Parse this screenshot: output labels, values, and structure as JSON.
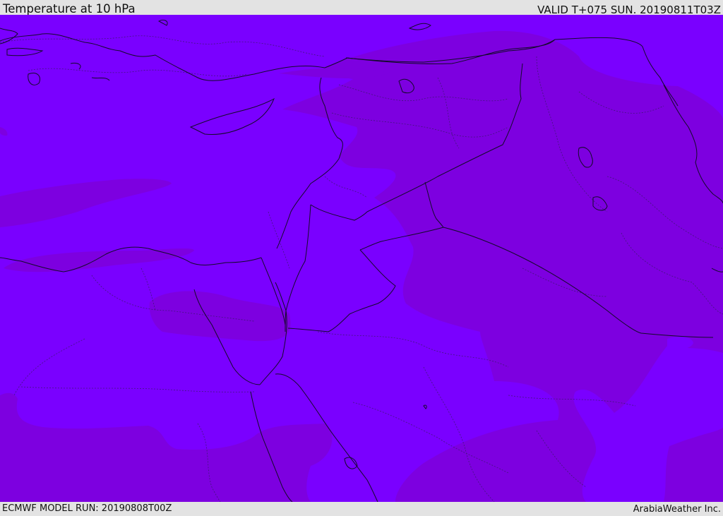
{
  "header": {
    "title": "Temperature at 10 hPa",
    "valid": "VALID T+075 SUN. 20190811T03Z"
  },
  "footer": {
    "model_run": "ECMWF MODEL RUN: 20190808T00Z",
    "credit": "ArabiaWeather Inc."
  },
  "colors": {
    "band_light": "#7a00ff",
    "band_dark": "#7d00e0",
    "frame": "#e3e3e3",
    "lines": "#140a2a"
  }
}
